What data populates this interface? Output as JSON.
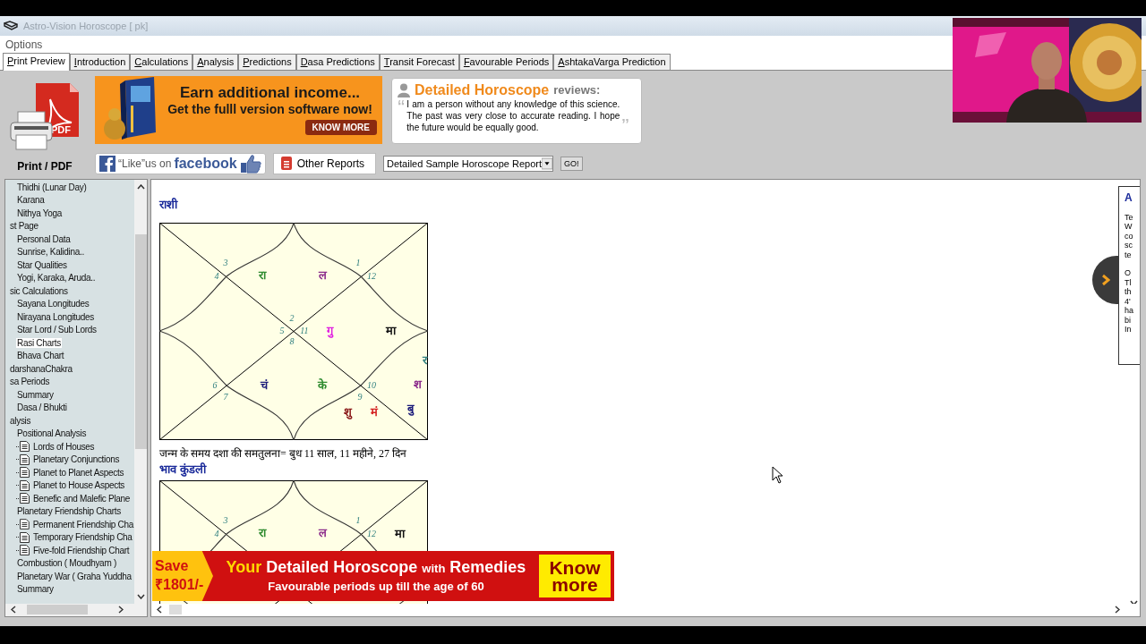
{
  "window": {
    "title": "Astro-Vision Horoscope [ pk]"
  },
  "menu": [
    "Options"
  ],
  "tabs": [
    {
      "label": "Print Preview",
      "selected": true
    },
    {
      "label": "Introduction",
      "selected": false
    },
    {
      "label": "Calculations",
      "selected": false
    },
    {
      "label": "Analysis",
      "selected": false
    },
    {
      "label": "Predictions",
      "selected": false
    },
    {
      "label": "Dasa Predictions",
      "selected": false
    },
    {
      "label": "Transit Forecast",
      "selected": false
    },
    {
      "label": "Favourable Periods",
      "selected": false
    },
    {
      "label": "AshtakaVarga Prediction",
      "selected": false
    }
  ],
  "toolbar": {
    "print_icon_text": "PDF",
    "print_label": "Print / PDF",
    "ad": {
      "line1": "Earn additional income...",
      "line2": "Get the fulll version software now!",
      "button": "KNOW MORE"
    },
    "review": {
      "brand": "Detailed Horoscope",
      "suffix": "reviews:",
      "open_quote": "‘‘",
      "close_quote": "’’",
      "text": "I am a person without any knowledge of this science. The past was very close to accurate reading. I hope the future would be equally good."
    },
    "facebook": {
      "prefix": "“Like”us on",
      "brand": "facebook"
    },
    "other_reports": "Other Reports",
    "report_select": {
      "value": "Detailed Sample Horoscope Report"
    },
    "go": "GO!"
  },
  "sidebar": {
    "tree": [
      {
        "children": [
          {
            "label": "Thidhi (Lunar Day)",
            "selected": false
          },
          {
            "label": "Karana",
            "selected": false
          },
          {
            "label": "Nithya Yoga",
            "selected": false
          }
        ]
      },
      {
        "label": "st Page",
        "selected": false,
        "children": [
          {
            "label": "Personal Data",
            "selected": false
          },
          {
            "label": "Sunrise, Kalidina..",
            "selected": false
          },
          {
            "label": "Star Qualities",
            "selected": false
          },
          {
            "label": "Yogi, Karaka, Aruda..",
            "selected": false
          }
        ]
      },
      {
        "label": "sic Calculations",
        "selected": false,
        "children": [
          {
            "label": "Sayana Longitudes",
            "selected": false
          },
          {
            "label": "Nirayana Longitudes",
            "selected": false
          },
          {
            "label": "Star Lord / Sub Lords",
            "selected": false
          },
          {
            "label": "Rasi Charts",
            "selected": true
          },
          {
            "label": "Bhava Chart",
            "selected": false
          }
        ]
      },
      {
        "label": "darshanaChakra",
        "selected": false
      },
      {
        "label": "sa Periods",
        "selected": false,
        "children": [
          {
            "label": "Summary",
            "selected": false
          },
          {
            "label": "Dasa / Bhukti",
            "selected": false
          }
        ]
      },
      {
        "label": "alysis",
        "selected": false,
        "children": [
          {
            "label": "Positional Analysis",
            "selected": false,
            "children": [
              {
                "label": "Lords of Houses",
                "selected": false
              },
              {
                "label": "Planetary Conjunctions",
                "selected": false
              },
              {
                "label": "Planet to Planet Aspects",
                "selected": false
              },
              {
                "label": "Planet to House Aspects",
                "selected": false
              },
              {
                "label": "Benefic and Malefic Plane",
                "selected": false
              }
            ]
          },
          {
            "label": "Planetary Friendship Charts",
            "selected": false,
            "children": [
              {
                "label": "Permanent Friendship Cha",
                "selected": false
              },
              {
                "label": "Temporary Friendship Cha",
                "selected": false
              },
              {
                "label": "Five-fold Friendship Chart",
                "selected": false
              }
            ]
          },
          {
            "label": "Combustion ( Moudhyam )",
            "selected": false
          },
          {
            "label": "Planetary War ( Graha Yuddha",
            "selected": false
          },
          {
            "label": "Summary",
            "selected": false
          }
        ]
      }
    ]
  },
  "content": {
    "rasi_heading": "राशी",
    "rasi_chart": {
      "houses": {
        "top": {
          "sign": "2",
          "planets": [
            {
              "text": "रा",
              "color": "#2e8b2e"
            },
            {
              "text": "ल",
              "color": "#8b2a8b"
            }
          ]
        },
        "upper_left": {
          "sign": "3"
        },
        "left_upper": {
          "sign": "4"
        },
        "left": {
          "sign": "5"
        },
        "left_lower": {
          "sign": "6"
        },
        "lower_left": {
          "sign": "7"
        },
        "bottom": {
          "sign": "8",
          "planets": [
            {
              "text": "चं",
              "color": "#1a1a7a"
            },
            {
              "text": "के",
              "color": "#2e8b2e"
            }
          ]
        },
        "lower_right": {
          "sign": "9",
          "planets": [
            {
              "text": "शु",
              "color": "#8b1a1a"
            },
            {
              "text": "मं",
              "color": "#d42020"
            }
          ]
        },
        "right_lower": {
          "sign": "10",
          "planets": [
            {
              "text": "र",
              "color": "#2f7f7f"
            },
            {
              "text": "श",
              "color": "#8b2a8b"
            },
            {
              "text": "बु",
              "color": "#1a1a7a"
            }
          ]
        },
        "right": {
          "sign": "11",
          "planets": [
            {
              "text": "गु",
              "color": "#e020e0"
            },
            {
              "text": "मा",
              "color": "#111111"
            }
          ]
        },
        "right_upper": {
          "sign": "12"
        },
        "upper_right": {
          "sign": "1"
        }
      }
    },
    "dasa_balance": "जन्म के समय दशा की समतुलना= बुध 11 साल, 11 महीने, 27 दिन",
    "bhava_heading": "भाव कुंडली",
    "bhava_chart": {
      "houses": {
        "top": {
          "planets": [
            {
              "text": "रा",
              "color": "#2e8b2e"
            },
            {
              "text": "ल",
              "color": "#8b2a8b"
            }
          ]
        },
        "upper_left": {
          "sign": "3"
        },
        "left_upper": {
          "sign": "4"
        },
        "right_upper": {
          "sign": "12",
          "planets": [
            {
              "text": "मा",
              "color": "#111111"
            }
          ]
        },
        "upper_right": {
          "sign": "1"
        }
      }
    },
    "side_panel": {
      "heading": "A",
      "lines": [
        "Te",
        "W",
        "co",
        "sc",
        "te",
        "O",
        "Tl",
        "th",
        "4'",
        "ha",
        "bi",
        "In"
      ]
    }
  },
  "banner": {
    "save": "Save",
    "price": "₹1801/-",
    "headline": [
      {
        "text": "Your",
        "kind": "accent"
      },
      {
        "text": "Detailed Horoscope",
        "kind": "plain"
      },
      {
        "text": "with",
        "kind": "small"
      },
      {
        "text": "Remedies",
        "kind": "plain"
      }
    ],
    "subline": "Favourable periods up till the age of 60",
    "button": "Know more"
  },
  "webcam": {
    "kind": "picture"
  }
}
